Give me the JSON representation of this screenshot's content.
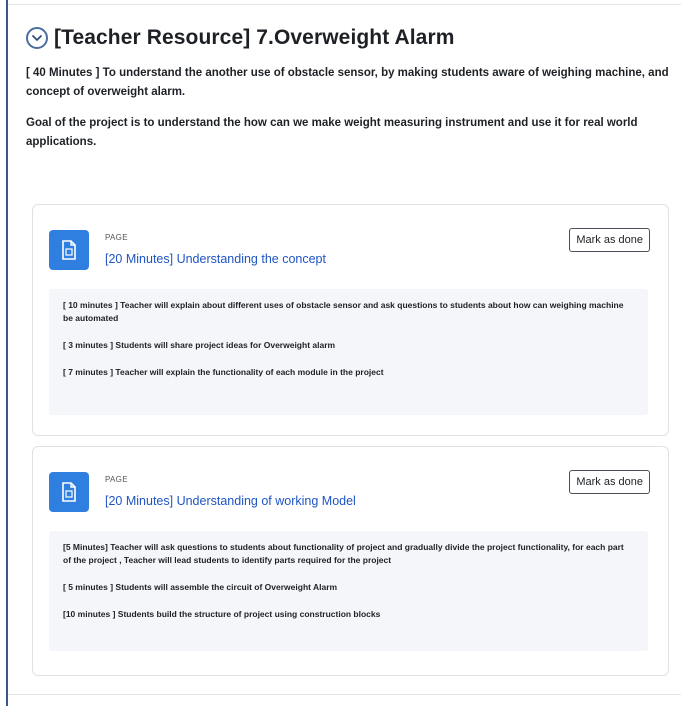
{
  "section": {
    "title": "[Teacher Resource] 7.Overweight Alarm",
    "summary": [
      "[ 40 Minutes ] To understand the another use of obstacle sensor, by making students aware of weighing machine, and concept of overweight alarm.",
      "Goal of the project is to understand the how can we make weight measuring instrument and use it for real world applications."
    ]
  },
  "activities": [
    {
      "type": "PAGE",
      "title": "[20 Minutes] Understanding the concept",
      "button": "Mark as done",
      "description": [
        "[ 10 minutes ] Teacher will explain about different uses of obstacle sensor and ask questions to students about how can weighing machine be automated",
        "[ 3 minutes ] Students will share project ideas for Overweight alarm",
        "[ 7 minutes ] Teacher will explain the functionality of each module in the project"
      ]
    },
    {
      "type": "PAGE",
      "title": "[20 Minutes] Understanding of working Model",
      "button": "Mark as done",
      "description": [
        "[5 Minutes] Teacher will ask questions to students about functionality of project and gradually divide the project functionality, for each part of the project , Teacher will lead students to identify parts required for the project",
        "[ 5 minutes ] Students will assemble the circuit of Overweight Alarm",
        "[10 minutes ] Students build the structure of project using construction blocks"
      ]
    }
  ],
  "icons": {
    "collapse": "chevron-down-icon",
    "page": "page-document-icon"
  },
  "colors": {
    "accent": "#2e7fe0",
    "link": "#1f55c4"
  }
}
